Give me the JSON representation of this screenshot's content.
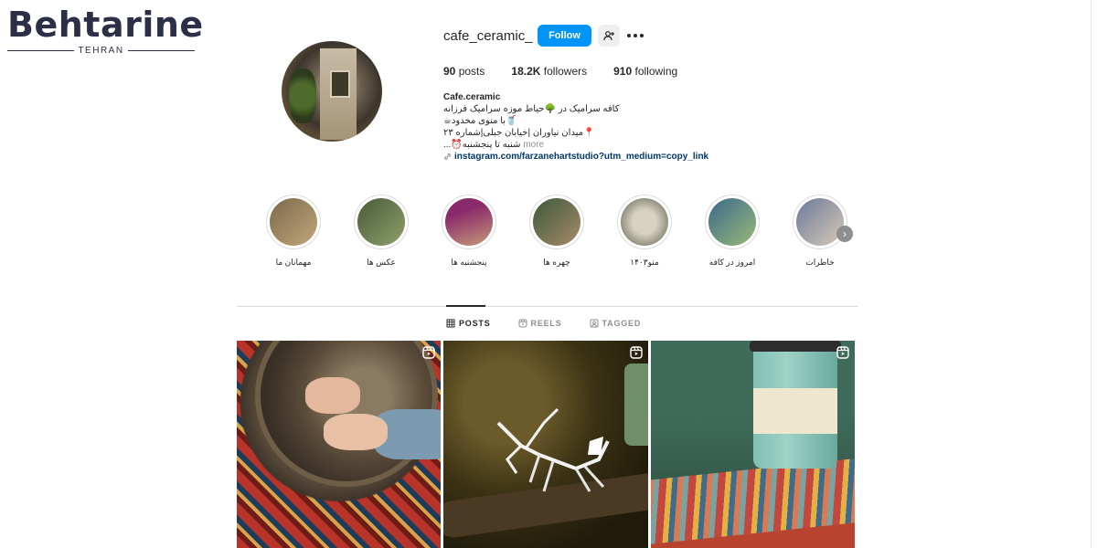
{
  "watermark": {
    "word": "Behtarine",
    "sub": "TEHRAN"
  },
  "profile": {
    "username": "cafe_ceramic_",
    "follow_label": "Follow",
    "stats": [
      {
        "value": "90",
        "label": "posts"
      },
      {
        "value": "18.2K",
        "label": "followers"
      },
      {
        "value": "910",
        "label": "following"
      }
    ],
    "bio": {
      "name": "Cafe.ceramic",
      "lines": [
        "کافه سرامیک در 🌳حیاط موزه سرامیک فرزانه",
        "🥤با منوی محدود☕",
        "📍میدان نیاوران |خیابان جبلی|شماره ۲۳",
        "شنبه تا پنجشنبه⏰..."
      ],
      "more": "more",
      "link": "instagram.com/farzanehartstudio?utm_medium=copy_link"
    }
  },
  "highlights": [
    {
      "label": "مهمانان ما",
      "color_a": "#7a6a4a",
      "color_b": "#c2a67a"
    },
    {
      "label": "عکس ها",
      "color_a": "#4a5a3a",
      "color_b": "#8fa06a"
    },
    {
      "label": "پنجشنبه ها",
      "color_a": "#8a2a6a",
      "color_b": "#c79a7a"
    },
    {
      "label": "چهره ها",
      "color_a": "#3b5a3a",
      "color_b": "#a88a6a"
    },
    {
      "label": "منو۱۴۰۳",
      "color_a": "#5a5a48",
      "color_b": "#d8d2c2"
    },
    {
      "label": "امروز در کافه",
      "color_a": "#3a6a8a",
      "color_b": "#9ab87a"
    },
    {
      "label": "خاطرات",
      "color_a": "#6a7a9a",
      "color_b": "#d8c8b8"
    }
  ],
  "tabs": [
    {
      "label": "POSTS",
      "icon": "grid-icon",
      "active": true
    },
    {
      "label": "REELS",
      "icon": "reels-icon",
      "active": false
    },
    {
      "label": "TAGGED",
      "icon": "tagged-icon",
      "active": false
    }
  ],
  "colors": {
    "follow_button": "#0095f6",
    "link": "#00376b"
  }
}
